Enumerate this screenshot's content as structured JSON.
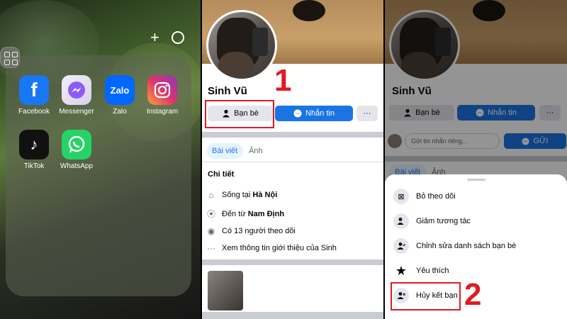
{
  "home": {
    "plus": "+",
    "apps": [
      {
        "label": "Facebook",
        "icon": "facebook-icon",
        "color": "#1877f2",
        "glyph": "f"
      },
      {
        "label": "Messenger",
        "icon": "messenger-icon",
        "color": "#a779e9",
        "glyph": "⚡"
      },
      {
        "label": "Zalo",
        "icon": "zalo-icon",
        "color": "#0068ff",
        "glyph": "Zalo"
      },
      {
        "label": "Instagram",
        "icon": "instagram-icon",
        "color": "#d6249f",
        "glyph": "◎"
      },
      {
        "label": "TikTok",
        "icon": "tiktok-icon",
        "color": "#111111",
        "glyph": "♪"
      },
      {
        "label": "WhatsApp",
        "icon": "whatsapp-icon",
        "color": "#25d366",
        "glyph": "✆"
      }
    ]
  },
  "profile": {
    "name": "Sinh Vũ",
    "friends_button": "Bạn bè",
    "message_button": "Nhắn tin",
    "more_button": "···",
    "step1": "1",
    "tabs": [
      "Bài viết",
      "Ảnh"
    ],
    "details_title": "Chi tiết",
    "details": {
      "lives_prefix": "Sống tại ",
      "lives_place": "Hà Nội",
      "from_prefix": "Đến từ ",
      "from_place": "Nam Định",
      "followers": "Có 13 người theo dõi",
      "about": "Xem thông tin giới thiệu của Sinh"
    }
  },
  "sheet_view": {
    "name": "Sinh Vũ",
    "friends_button": "Bạn bè",
    "message_button": "Nhắn tin",
    "more_button": "···",
    "message_placeholder": "Gửi tin nhắn riêng...",
    "send_button": "GỬI",
    "tabs": [
      "Bài viết",
      "Ảnh"
    ],
    "menu": [
      {
        "label": "Bỏ theo dõi",
        "icon": "unfollow-icon"
      },
      {
        "label": "Giảm tương tác",
        "icon": "reduce-interaction-icon"
      },
      {
        "label": "Chỉnh sửa danh sách bạn bè",
        "icon": "edit-friend-list-icon"
      },
      {
        "label": "Yêu thích",
        "icon": "star-icon"
      },
      {
        "label": "Hủy kết bạn",
        "icon": "unfriend-icon"
      }
    ],
    "step2": "2"
  },
  "colors": {
    "fb_blue": "#1b74e4",
    "highlight_red": "#e01b24"
  }
}
